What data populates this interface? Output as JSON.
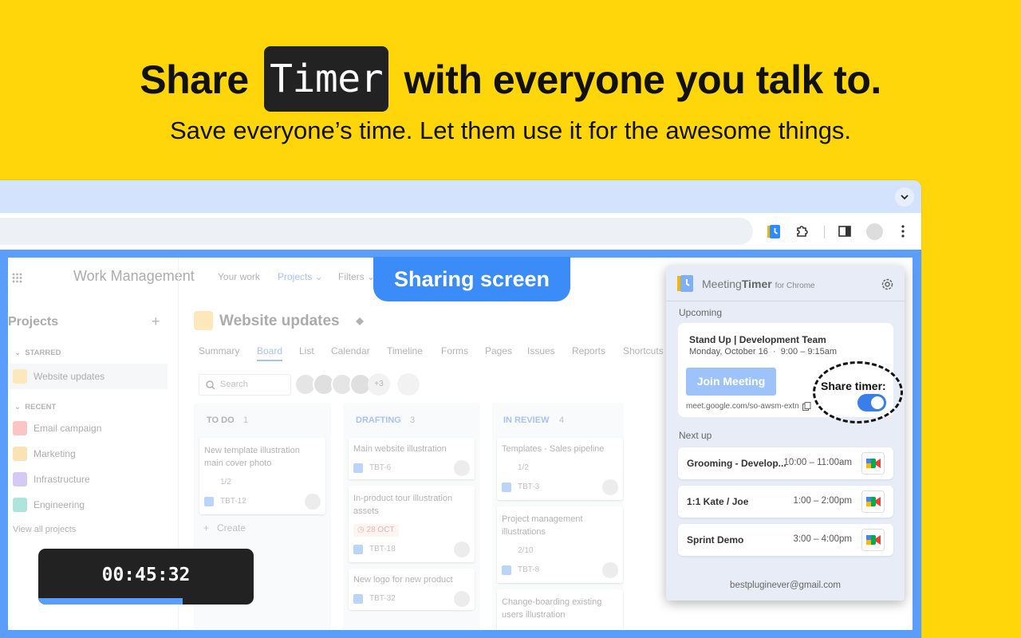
{
  "hero": {
    "title_before": "Share",
    "title_pill": "Timer",
    "title_after": "with everyone you talk to.",
    "subtitle": "Save everyone’s time. Let them use it for the awesome things."
  },
  "sharing_label": "Sharing screen",
  "timer": {
    "display": "00:45:32",
    "progress": 0.67
  },
  "app": {
    "brand": "Work Management",
    "nav": [
      "Your work",
      "Projects",
      "Filters"
    ],
    "sidebar": {
      "title": "Projects",
      "starred_heading": "STARRED",
      "starred": [
        "Website updates"
      ],
      "recent_heading": "RECENT",
      "recent": [
        "Email campaign",
        "Marketing",
        "Infrastructure",
        "Engineering"
      ],
      "view_all": "View all projects"
    },
    "project_title": "Website updates",
    "tabs": [
      "Summary",
      "Board",
      "List",
      "Calendar",
      "Timeline",
      "Forms",
      "Pages",
      "Issues",
      "Reports",
      "Shortcuts"
    ],
    "search_placeholder": "Search",
    "avatar_more": "+3",
    "columns": [
      {
        "name": "TO DO",
        "count": "1",
        "cards": [
          {
            "title": "New template illustration main cover photo",
            "sub": "1/2",
            "key": "TBT-12"
          }
        ],
        "create": "Create"
      },
      {
        "name": "DRAFTING",
        "count": "3",
        "cards": [
          {
            "title": "Main website illustration",
            "key": "TBT-6"
          },
          {
            "title": "In-product tour illustration assets",
            "date": "28 OCT",
            "key": "TBT-18"
          },
          {
            "title": "New logo for new product",
            "key": "TBT-32"
          }
        ]
      },
      {
        "name": "IN REVIEW",
        "count": "4",
        "cards": [
          {
            "title": "Templates - Sales pipeline",
            "sub": "1/2",
            "key": "TBT-3"
          },
          {
            "title": "Project management illustrations",
            "sub": "2/10",
            "key": "TBT-8"
          },
          {
            "title": "Change-boarding existing users illustration"
          }
        ]
      }
    ]
  },
  "popup": {
    "brand_a": "Meeting",
    "brand_b": "Timer",
    "brand_c": "for Chrome",
    "upcoming_label": "Upcoming",
    "event": {
      "title": "Stand Up | Development Team",
      "when": "Monday, October 16  ·  9:00 – 9:15am",
      "join_label": "Join Meeting",
      "link": "meet.google.com/so-awsm-extn",
      "share_label": "Share timer:",
      "share_on": true
    },
    "next_label": "Next up",
    "next": [
      {
        "name": "Grooming - Develop...",
        "time": "10:00 – 11:00am"
      },
      {
        "name": "1:1 Kate / Joe",
        "time": "1:00 – 2:00pm"
      },
      {
        "name": "Sprint Demo",
        "time": "3:00 – 4:00pm"
      }
    ],
    "footer_email": "bestpluginever@gmail.com"
  },
  "colors": {
    "background": "#FFD60A",
    "accent_blue": "#3B8BF8",
    "timer_bg": "#222222"
  }
}
